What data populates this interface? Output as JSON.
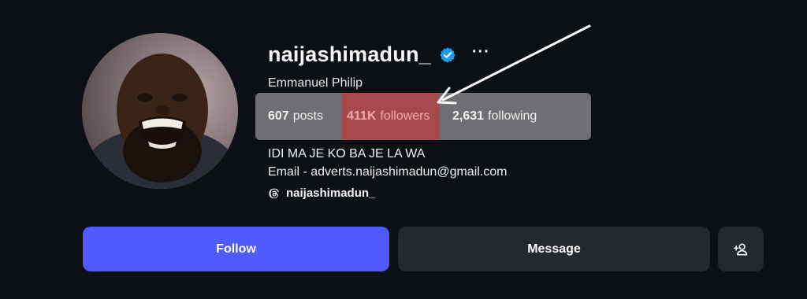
{
  "profile": {
    "username": "naijashimadun_",
    "more_label": "···",
    "full_name": "Emmanuel Philip",
    "stats": {
      "posts_count": "607",
      "posts_label": "posts",
      "followers_count": "411K",
      "followers_label": "followers",
      "following_count": "2,631",
      "following_label": "following"
    },
    "bio_line_1": "IDI MA JE KO BA JE LA WA",
    "bio_line_2": "Email - adverts.naijashimadun@gmail.com",
    "threads_handle": "naijashimadun_"
  },
  "actions": {
    "follow_label": "Follow",
    "message_label": "Message",
    "add_user_icon": "add-person-icon"
  },
  "colors": {
    "background": "#0c1014",
    "follow_button": "#4f5bff",
    "secondary_button": "#25292e",
    "verified_badge": "#1d9bf0",
    "stats_highlight": "#6d6f72",
    "followers_highlight": "#a84a4d"
  }
}
